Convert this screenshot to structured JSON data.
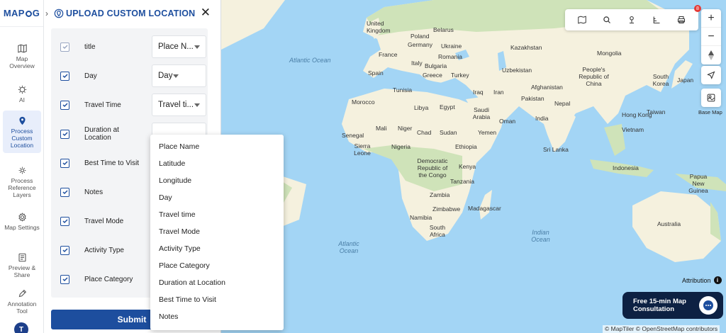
{
  "app": {
    "logo": "MAPOG",
    "avatar_initial": "T"
  },
  "rail": [
    {
      "label": "Map Overview",
      "icon": "map-icon"
    },
    {
      "label": "AI",
      "icon": "ai-icon"
    },
    {
      "label": "Process Custom Location",
      "icon": "location-pin-icon",
      "active": true
    },
    {
      "label": "Process Reference Layers",
      "icon": "layers-gear-icon"
    },
    {
      "label": "Map Settings",
      "icon": "settings-icon"
    },
    {
      "label": "Preview & Share",
      "icon": "preview-icon"
    },
    {
      "label": "Annotation Tool",
      "icon": "annotation-icon"
    }
  ],
  "panel": {
    "title": "UPLOAD CUSTOM LOCATION",
    "close": "✕",
    "rows": [
      {
        "label": "title",
        "value": "Place N...",
        "checked": true,
        "dim": true
      },
      {
        "label": "Day",
        "value": "Day",
        "checked": true
      },
      {
        "label": "Travel Time",
        "value": "Travel ti...",
        "checked": true
      },
      {
        "label": "Duration at Location",
        "value": "",
        "checked": true
      },
      {
        "label": "Best Time to Visit",
        "value": "",
        "checked": true
      },
      {
        "label": "Notes",
        "value": "",
        "checked": true
      },
      {
        "label": "Travel Mode",
        "value": "",
        "checked": true
      },
      {
        "label": "Activity Type",
        "value": "",
        "checked": true
      },
      {
        "label": "Place Category",
        "value": "",
        "checked": true
      }
    ],
    "submit": "Submit"
  },
  "dropdown": {
    "options": [
      "Place Name",
      "Latitude",
      "Longitude",
      "Day",
      "Travel time",
      "Travel Mode",
      "Activity Type",
      "Place Category",
      "Duration at Location",
      "Best Time to Visit",
      "Notes"
    ]
  },
  "map": {
    "oceans": [
      "Atlantic Ocean",
      "Atlantic Ocean",
      "Indian Ocean"
    ],
    "labels": [
      "United Kingdom",
      "Belarus",
      "Poland",
      "Ukraine",
      "Kazakhstan",
      "Mongolia",
      "Germany",
      "France",
      "Romania",
      "Italy",
      "Bulgaria",
      "Uzbekistan",
      "Spain",
      "Greece",
      "Turkey",
      "People's Republic of China",
      "South Korea",
      "Japan",
      "Tunisia",
      "Iraq",
      "Iran",
      "Afghanistan",
      "Pakistan",
      "Morocco",
      "Libya",
      "Egypt",
      "Saudi Arabia",
      "Nepal",
      "India",
      "Hong Kong",
      "Taiwan",
      "Oman",
      "Mali",
      "Niger",
      "Chad",
      "Sudan",
      "Yemen",
      "Vietnam",
      "Senegal",
      "Nigeria",
      "Ethiopia",
      "Sri Lanka",
      "Sierra Leone",
      "Kenya",
      "Democratic Republic of the Congo",
      "Indonesia",
      "Tanzania",
      "Papua New Guinea",
      "Zambia",
      "Zimbabwe",
      "Madagascar",
      "Namibia",
      "South Africa",
      "Australia"
    ],
    "base_map_label": "Base Map",
    "attribution": "Attribution",
    "consult": "Free 15-min Map Consultation",
    "copyright": "© MapTiler © OpenStreetMap contributors",
    "notif_count": "8",
    "toolbar_icons": [
      "map-style-icon",
      "search-icon",
      "location-marker-icon",
      "measure-icon",
      "print-icon"
    ]
  },
  "colors": {
    "brand": "#1d4e9e",
    "land": "#f5f1de",
    "water": "#a3d5f5",
    "forest": "#cfe3b9",
    "consult_bg": "#0d2143"
  }
}
